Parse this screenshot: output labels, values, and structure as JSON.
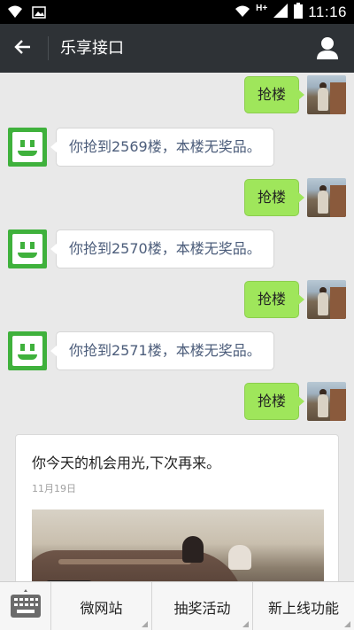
{
  "status_bar": {
    "time": "11:16",
    "network": "H+",
    "icons": [
      "wifi-icon",
      "image-icon",
      "signal-icon",
      "battery-icon"
    ]
  },
  "header": {
    "title": "乐享接口",
    "back_icon": "arrow-left-icon",
    "profile_icon": "person-icon"
  },
  "messages": [
    {
      "from": "me",
      "text": "抢楼"
    },
    {
      "from": "bot",
      "text": "你抢到2569楼，本楼无奖品。"
    },
    {
      "from": "me",
      "text": "抢楼"
    },
    {
      "from": "bot",
      "text": "你抢到2570楼，本楼无奖品。"
    },
    {
      "from": "me",
      "text": "抢楼"
    },
    {
      "from": "bot",
      "text": "你抢到2571楼，本楼无奖品。"
    },
    {
      "from": "me",
      "text": "抢楼"
    }
  ],
  "card": {
    "title": "你今天的机会用光,下次再来。",
    "date": "11月19日"
  },
  "bottom_menu": {
    "keyboard_icon": "keyboard-icon",
    "items": [
      "微网站",
      "抽奖活动",
      "新上线功能"
    ]
  },
  "colors": {
    "title_bar": "#2e3236",
    "my_bubble": "#9fe65b",
    "bot_avatar": "#3fb13c",
    "chat_background": "#e9e9e9"
  }
}
